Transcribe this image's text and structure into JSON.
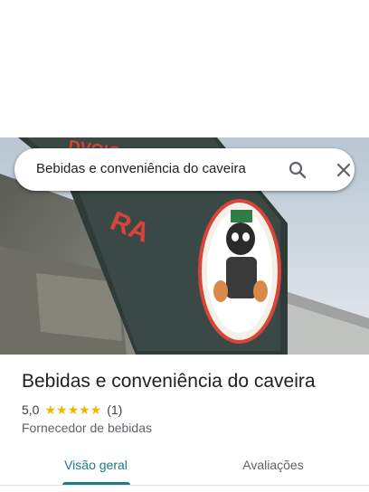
{
  "search": {
    "query": "Bebidas e conveniência do caveira",
    "search_icon": "search-icon",
    "close_icon": "close-icon"
  },
  "place": {
    "name": "Bebidas e conveniência do caveira",
    "rating": "5,0",
    "stars": "★★★★★",
    "star_value": 5,
    "review_count": "(1)",
    "category": "Fornecedor de bebidas"
  },
  "tabs": [
    {
      "label": "Visão geral",
      "selected": true
    },
    {
      "label": "Avaliações",
      "selected": false
    }
  ],
  "colors": {
    "accent": "#1a7a87",
    "star": "#f4b400"
  }
}
